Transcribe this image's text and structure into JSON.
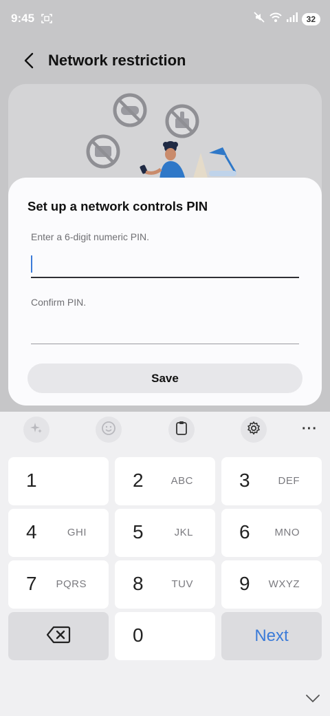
{
  "status_bar": {
    "time": "9:45",
    "battery_level": "32",
    "icons": [
      "screenshot-icon",
      "mute-icon",
      "wifi-icon",
      "signal-icon",
      "battery-icon"
    ]
  },
  "header": {
    "title": "Network restriction",
    "back_icon": "chevron-left-icon"
  },
  "dialog": {
    "title": "Set up a network controls PIN",
    "pin_label": "Enter a 6-digit numeric PIN.",
    "confirm_label": "Confirm PIN.",
    "pin_value": "",
    "confirm_value": "",
    "save_label": "Save"
  },
  "keyboard": {
    "toolbar": [
      "ai-sparkle-icon",
      "emoji-icon",
      "clipboard-icon",
      "settings-icon",
      "more-icon"
    ],
    "more_label": "···",
    "keys": [
      {
        "num": "1",
        "letters": ""
      },
      {
        "num": "2",
        "letters": "ABC"
      },
      {
        "num": "3",
        "letters": "DEF"
      },
      {
        "num": "4",
        "letters": "GHI"
      },
      {
        "num": "5",
        "letters": "JKL"
      },
      {
        "num": "6",
        "letters": "MNO"
      },
      {
        "num": "7",
        "letters": "PQRS"
      },
      {
        "num": "8",
        "letters": "TUV"
      },
      {
        "num": "9",
        "letters": "WXYZ"
      }
    ],
    "zero": "0",
    "next_label": "Next",
    "accent_color": "#3b7bd8"
  }
}
